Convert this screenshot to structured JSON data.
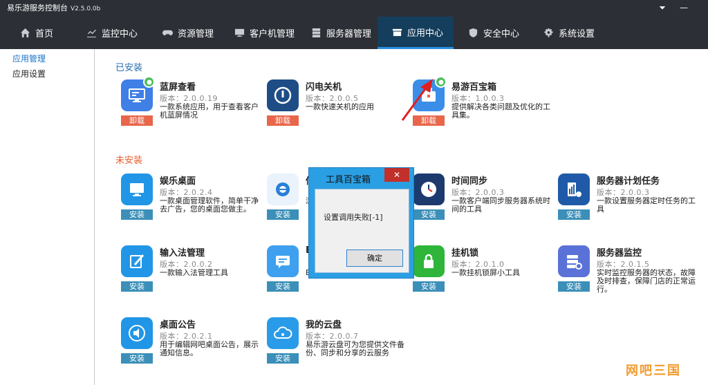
{
  "window": {
    "title": "易乐游服务控制台",
    "version": "V2.5.0.0b",
    "menu_glyph": "⏷",
    "minimize_glyph": "—"
  },
  "nav": {
    "items": [
      {
        "label": "首页",
        "icon": "home-icon"
      },
      {
        "label": "监控中心",
        "icon": "chart-icon"
      },
      {
        "label": "资源管理",
        "icon": "gamepad-icon"
      },
      {
        "label": "客户机管理",
        "icon": "monitor-icon"
      },
      {
        "label": "服务器管理",
        "icon": "server-icon"
      },
      {
        "label": "应用中心",
        "icon": "box-icon",
        "active": true
      },
      {
        "label": "安全中心",
        "icon": "shield-icon"
      },
      {
        "label": "系统设置",
        "icon": "gear-icon"
      }
    ]
  },
  "sidebar": {
    "items": [
      {
        "label": "应用管理",
        "active": true
      },
      {
        "label": "应用设置"
      }
    ]
  },
  "sections": {
    "installed": "已安装",
    "uninstalled": "未安装"
  },
  "actions": {
    "uninstall": "卸载",
    "install": "安装"
  },
  "installed_apps": [
    {
      "name": "蓝屏查看",
      "version": "版本：2.0.0.19",
      "desc": "一款系统应用，用于查看客户机蓝屏情况"
    },
    {
      "name": "闪电关机",
      "version": "版本：2.0.0.5",
      "desc": "一款快速关机的应用"
    },
    {
      "name": "易游百宝箱",
      "version": "版本：1.0.0.3",
      "desc": "提供解决各类问题及优化的工具集。"
    }
  ],
  "uninstalled_apps": [
    {
      "name": "娱乐桌面",
      "version": "版本：2.0.2.4",
      "desc": "一款桌面管理软件，简单干净去广告，您的桌面您做主。"
    },
    {
      "name": "信",
      "version": "",
      "desc": "浏"
    },
    {
      "name": "时间同步",
      "version": "版本：2.0.0.3",
      "desc": "一款客户端同步服务器系统时间的工具"
    },
    {
      "name": "服务器计划任务",
      "version": "版本：2.0.0.3",
      "desc": "一款设置服务器定时任务的工具"
    },
    {
      "name": "输入法管理",
      "version": "版本：2.0.0.2",
      "desc": "一款输入法管理工具"
    },
    {
      "name": "E",
      "version": "",
      "desc": "E"
    },
    {
      "name": "挂机锁",
      "version": "版本：2.0.1.0",
      "desc": "一款挂机锁屏小工具"
    },
    {
      "name": "服务器监控",
      "version": "版本：2.0.1.5",
      "desc": "实时监控服务器的状态，故障及时排查，保障门店的正常运行。"
    },
    {
      "name": "桌面公告",
      "version": "版本：2.0.2.1",
      "desc": "用于编辑网吧桌面公告，展示通知信息。"
    },
    {
      "name": "我的云盘",
      "version": "版本：2.0.0.7",
      "desc": "易乐游云盘可为您提供文件备份、同步和分享的云服务"
    }
  ],
  "modal": {
    "title": "工具百宝箱",
    "close_glyph": "✕",
    "message": "设置调用失败[-1]",
    "ok_label": "确定"
  },
  "watermark": "网吧三国",
  "colors": {
    "topbar": "#2c2f36",
    "nav_active": "#153e5c",
    "installed_heading": "#2a6fb0",
    "uninstalled_heading": "#e85b2a",
    "uninstall_button": "#e8664a",
    "install_button": "#3b8fb8",
    "modal_frame": "#2b9fe4"
  }
}
